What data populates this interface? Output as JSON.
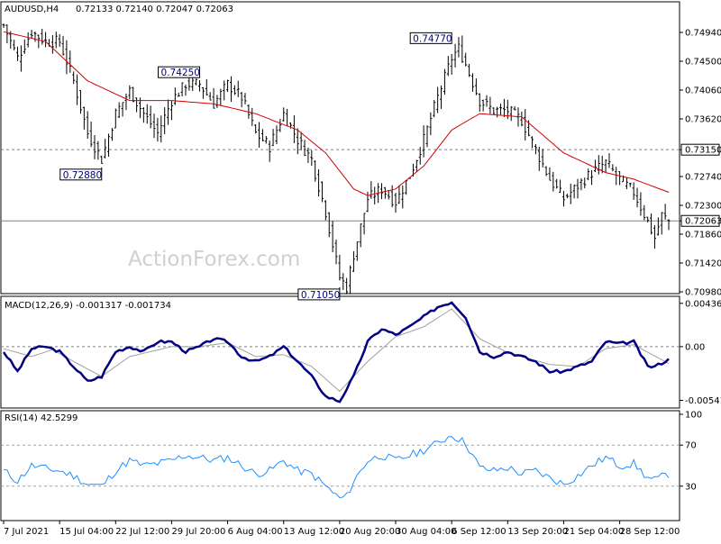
{
  "title": {
    "symbol": "AUDUSD,H4",
    "ohlc": "0.72133 0.72140 0.72047 0.72063"
  },
  "watermark": "ActionForex.com",
  "colors": {
    "price": "#000000",
    "ma": "#d10000",
    "macd": "#000080",
    "signal": "#a0a0a0",
    "rsi": "#1e90ff",
    "level_line": "#808080"
  },
  "chart_data": [
    {
      "type": "bar",
      "name": "price",
      "ylim": [
        0.7098,
        0.7538
      ],
      "y_ticks": [
        "0.74940",
        "0.74500",
        "0.74060",
        "0.73620",
        "0.73150",
        "0.72740",
        "0.72300",
        "0.72063",
        "0.71860",
        "0.71420",
        "0.70980"
      ],
      "y_tick_values": [
        0.7494,
        0.745,
        0.7406,
        0.7362,
        0.7315,
        0.7274,
        0.723,
        0.72063,
        0.7186,
        0.7142,
        0.7098
      ],
      "horizontal_levels": [
        {
          "label": "0.73150",
          "value": 0.7315,
          "style": "dashed"
        },
        {
          "label": "0.72063",
          "value": 0.72063,
          "style": "solid"
        }
      ],
      "annotations": [
        {
          "label": "0.72880",
          "value": 0.7288,
          "x_index": 28
        },
        {
          "label": "0.74250",
          "value": 0.7425,
          "x_index": 56
        },
        {
          "label": "0.71050",
          "value": 0.7105,
          "x_index": 96
        },
        {
          "label": "0.74770",
          "value": 0.7477,
          "x_index": 128
        }
      ],
      "price_anchors": [
        [
          0,
          0.7505
        ],
        [
          4,
          0.7455
        ],
        [
          8,
          0.7495
        ],
        [
          12,
          0.748
        ],
        [
          16,
          0.748
        ],
        [
          20,
          0.742
        ],
        [
          24,
          0.734
        ],
        [
          28,
          0.73
        ],
        [
          32,
          0.737
        ],
        [
          36,
          0.7405
        ],
        [
          40,
          0.737
        ],
        [
          44,
          0.734
        ],
        [
          48,
          0.739
        ],
        [
          52,
          0.7415
        ],
        [
          56,
          0.7415
        ],
        [
          60,
          0.7385
        ],
        [
          64,
          0.7415
        ],
        [
          68,
          0.7395
        ],
        [
          72,
          0.734
        ],
        [
          76,
          0.732
        ],
        [
          80,
          0.737
        ],
        [
          84,
          0.733
        ],
        [
          88,
          0.73
        ],
        [
          92,
          0.722
        ],
        [
          96,
          0.712
        ],
        [
          98,
          0.7105
        ],
        [
          100,
          0.7155
        ],
        [
          104,
          0.724
        ],
        [
          108,
          0.7255
        ],
        [
          112,
          0.7235
        ],
        [
          116,
          0.7275
        ],
        [
          120,
          0.733
        ],
        [
          124,
          0.7395
        ],
        [
          128,
          0.7455
        ],
        [
          130,
          0.747
        ],
        [
          132,
          0.7445
        ],
        [
          136,
          0.739
        ],
        [
          140,
          0.7375
        ],
        [
          144,
          0.7375
        ],
        [
          148,
          0.736
        ],
        [
          152,
          0.7315
        ],
        [
          156,
          0.727
        ],
        [
          160,
          0.724
        ],
        [
          164,
          0.726
        ],
        [
          168,
          0.728
        ],
        [
          172,
          0.7295
        ],
        [
          176,
          0.727
        ],
        [
          180,
          0.725
        ],
        [
          184,
          0.7205
        ],
        [
          186,
          0.718
        ],
        [
          188,
          0.7215
        ],
        [
          190,
          0.7206
        ]
      ],
      "ma_anchors": [
        [
          0,
          0.7495
        ],
        [
          12,
          0.748
        ],
        [
          24,
          0.742
        ],
        [
          36,
          0.739
        ],
        [
          48,
          0.739
        ],
        [
          60,
          0.7385
        ],
        [
          72,
          0.737
        ],
        [
          84,
          0.7345
        ],
        [
          92,
          0.731
        ],
        [
          100,
          0.7255
        ],
        [
          104,
          0.7245
        ],
        [
          112,
          0.7255
        ],
        [
          120,
          0.729
        ],
        [
          128,
          0.7345
        ],
        [
          136,
          0.737
        ],
        [
          148,
          0.7365
        ],
        [
          160,
          0.731
        ],
        [
          172,
          0.728
        ],
        [
          180,
          0.727
        ],
        [
          190,
          0.725
        ]
      ]
    },
    {
      "type": "line",
      "name": "MACD(12,26,9)",
      "header": "MACD(12,26,9) -0.001317 -0.001734",
      "ylim": [
        -0.006,
        0.0048
      ],
      "y_ticks": [
        "0.004367",
        "0.00",
        "-0.005411"
      ],
      "y_tick_values": [
        0.004367,
        0.0,
        -0.005411
      ],
      "zero_label": "0.00",
      "macd_anchors": [
        [
          0,
          -0.0005
        ],
        [
          4,
          -0.0025
        ],
        [
          8,
          -0.0002
        ],
        [
          12,
          0.0
        ],
        [
          16,
          -0.0005
        ],
        [
          20,
          -0.002
        ],
        [
          24,
          -0.0035
        ],
        [
          28,
          -0.003
        ],
        [
          32,
          -0.0005
        ],
        [
          36,
          0.0
        ],
        [
          40,
          -0.0005
        ],
        [
          44,
          0.0005
        ],
        [
          48,
          0.0005
        ],
        [
          52,
          -0.0005
        ],
        [
          56,
          0.0
        ],
        [
          60,
          0.0008
        ],
        [
          64,
          0.0005
        ],
        [
          68,
          -0.001
        ],
        [
          72,
          -0.0015
        ],
        [
          76,
          -0.001
        ],
        [
          80,
          0.0
        ],
        [
          84,
          -0.0015
        ],
        [
          88,
          -0.003
        ],
        [
          92,
          -0.005
        ],
        [
          96,
          -0.0055
        ],
        [
          100,
          -0.003
        ],
        [
          104,
          0.0005
        ],
        [
          108,
          0.0018
        ],
        [
          112,
          0.0012
        ],
        [
          116,
          0.002
        ],
        [
          120,
          0.003
        ],
        [
          124,
          0.004
        ],
        [
          128,
          0.0045
        ],
        [
          132,
          0.003
        ],
        [
          136,
          -0.0005
        ],
        [
          140,
          -0.001
        ],
        [
          144,
          -0.0005
        ],
        [
          148,
          -0.001
        ],
        [
          152,
          -0.0015
        ],
        [
          156,
          -0.0025
        ],
        [
          160,
          -0.0025
        ],
        [
          164,
          -0.002
        ],
        [
          168,
          -0.0015
        ],
        [
          172,
          0.0005
        ],
        [
          176,
          0.0003
        ],
        [
          180,
          0.0005
        ],
        [
          184,
          -0.002
        ],
        [
          186,
          -0.002
        ],
        [
          190,
          -0.0013
        ]
      ],
      "signal_anchors": [
        [
          0,
          -0.0002
        ],
        [
          8,
          -0.001
        ],
        [
          14,
          -0.0003
        ],
        [
          20,
          -0.0015
        ],
        [
          28,
          -0.003
        ],
        [
          36,
          -0.001
        ],
        [
          48,
          0.0
        ],
        [
          56,
          0.0
        ],
        [
          64,
          0.0004
        ],
        [
          72,
          -0.001
        ],
        [
          80,
          -0.0008
        ],
        [
          88,
          -0.002
        ],
        [
          96,
          -0.0045
        ],
        [
          104,
          -0.0015
        ],
        [
          112,
          0.001
        ],
        [
          120,
          0.002
        ],
        [
          128,
          0.0038
        ],
        [
          136,
          0.0008
        ],
        [
          144,
          -0.0006
        ],
        [
          156,
          -0.0018
        ],
        [
          164,
          -0.002
        ],
        [
          172,
          -0.0002
        ],
        [
          180,
          0.0002
        ],
        [
          190,
          -0.0017
        ]
      ]
    },
    {
      "type": "line",
      "name": "RSI(14)",
      "header": "RSI(14) 42.5299",
      "ylim": [
        0,
        100
      ],
      "y_ticks": [
        "100",
        "70",
        "30"
      ],
      "y_tick_values": [
        100,
        70,
        30
      ],
      "levels": [
        70,
        30
      ],
      "rsi_anchors": [
        [
          0,
          45
        ],
        [
          4,
          35
        ],
        [
          8,
          50
        ],
        [
          12,
          47
        ],
        [
          16,
          45
        ],
        [
          20,
          40
        ],
        [
          24,
          32
        ],
        [
          28,
          30
        ],
        [
          32,
          45
        ],
        [
          36,
          55
        ],
        [
          40,
          50
        ],
        [
          44,
          52
        ],
        [
          48,
          55
        ],
        [
          52,
          60
        ],
        [
          56,
          58
        ],
        [
          60,
          55
        ],
        [
          64,
          58
        ],
        [
          68,
          50
        ],
        [
          72,
          42
        ],
        [
          76,
          45
        ],
        [
          80,
          55
        ],
        [
          84,
          45
        ],
        [
          88,
          42
        ],
        [
          92,
          30
        ],
        [
          96,
          18
        ],
        [
          98,
          20
        ],
        [
          100,
          35
        ],
        [
          104,
          55
        ],
        [
          108,
          60
        ],
        [
          112,
          55
        ],
        [
          116,
          60
        ],
        [
          120,
          65
        ],
        [
          124,
          72
        ],
        [
          128,
          80
        ],
        [
          130,
          76
        ],
        [
          132,
          72
        ],
        [
          136,
          48
        ],
        [
          140,
          45
        ],
        [
          144,
          48
        ],
        [
          148,
          42
        ],
        [
          152,
          45
        ],
        [
          156,
          38
        ],
        [
          160,
          32
        ],
        [
          164,
          40
        ],
        [
          168,
          50
        ],
        [
          172,
          58
        ],
        [
          176,
          50
        ],
        [
          180,
          52
        ],
        [
          184,
          38
        ],
        [
          186,
          36
        ],
        [
          190,
          42
        ]
      ]
    }
  ],
  "x_axis": {
    "labels": [
      "7 Jul 2021",
      "15 Jul 04:00",
      "22 Jul 12:00",
      "29 Jul 20:00",
      "6 Aug 04:00",
      "13 Aug 12:00",
      "20 Aug 20:00",
      "30 Aug 04:00",
      "6 Sep 12:00",
      "13 Sep 20:00",
      "21 Sep 04:00",
      "28 Sep 12:00"
    ],
    "label_indices": [
      0,
      16,
      32,
      48,
      64,
      80,
      96,
      112,
      128,
      144,
      160,
      176
    ],
    "bar_count": 191
  }
}
